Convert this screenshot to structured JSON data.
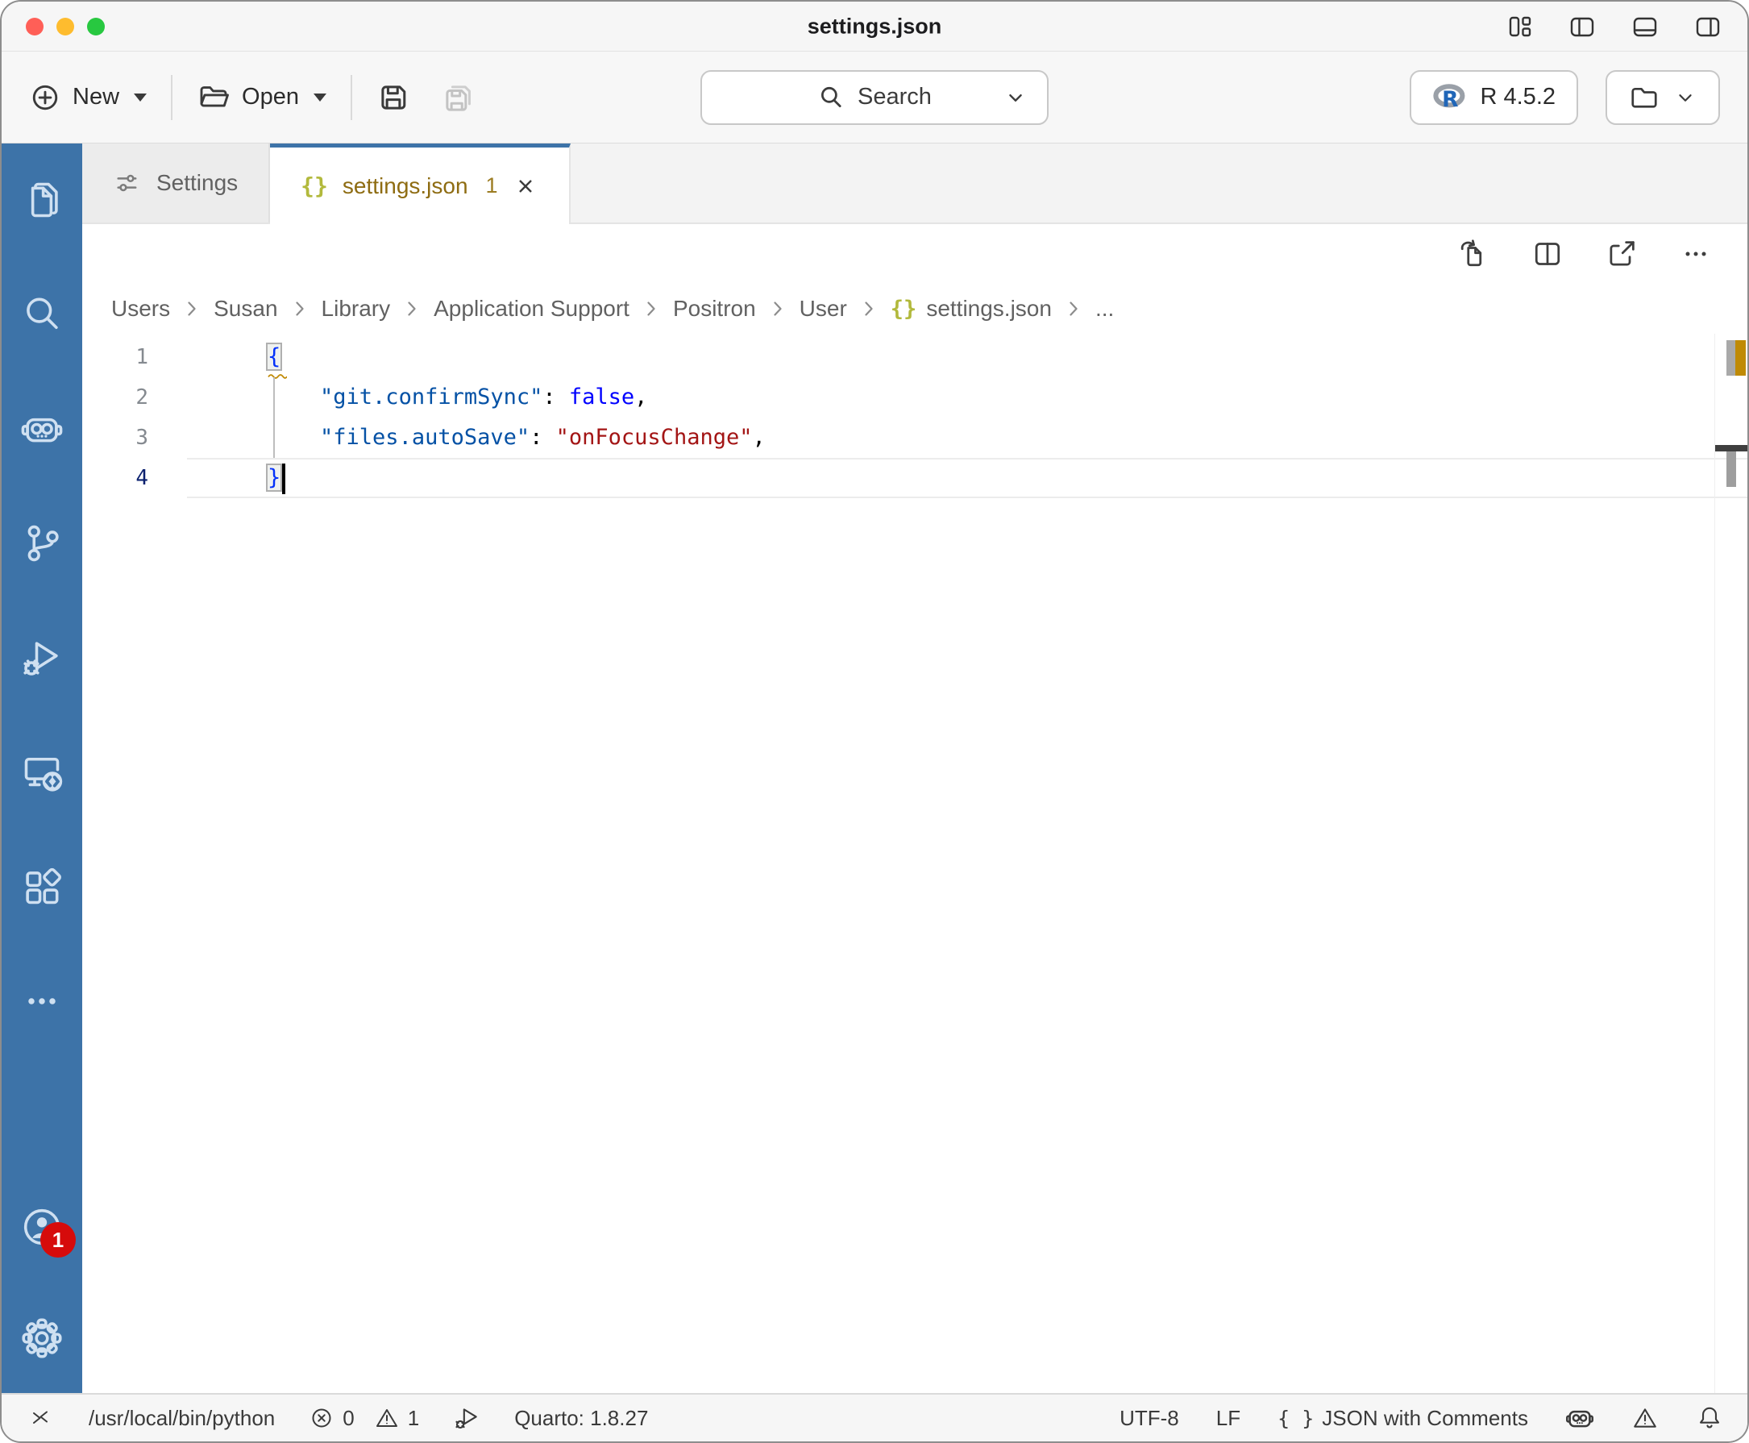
{
  "window": {
    "title": "settings.json"
  },
  "toolbar": {
    "new_label": "New",
    "open_label": "Open",
    "search_label": "Search",
    "r_runtime_label": "R 4.5.2"
  },
  "tabs": [
    {
      "label": "Settings"
    },
    {
      "label": "settings.json",
      "badge": "1"
    }
  ],
  "breadcrumb": {
    "items": [
      {
        "label": "Users"
      },
      {
        "label": "Susan"
      },
      {
        "label": "Library"
      },
      {
        "label": "Application Support"
      },
      {
        "label": "Positron"
      },
      {
        "label": "User"
      },
      {
        "label": "settings.json",
        "icon": "{}"
      },
      {
        "label": "..."
      }
    ]
  },
  "editor": {
    "lines": [
      {
        "num": "1",
        "tokens": [
          {
            "t": "{",
            "c": "br",
            "match": true,
            "squiggle": true
          }
        ]
      },
      {
        "num": "2",
        "tokens": [
          {
            "t": "    ",
            "c": "plain"
          },
          {
            "t": "\"git.confirmSync\"",
            "c": "key"
          },
          {
            "t": ": ",
            "c": "plain"
          },
          {
            "t": "false",
            "c": "kw"
          },
          {
            "t": ",",
            "c": "plain"
          }
        ]
      },
      {
        "num": "3",
        "tokens": [
          {
            "t": "    ",
            "c": "plain"
          },
          {
            "t": "\"files.autoSave\"",
            "c": "key"
          },
          {
            "t": ": ",
            "c": "plain"
          },
          {
            "t": "\"onFocusChange\"",
            "c": "str"
          },
          {
            "t": ",",
            "c": "plain"
          }
        ]
      },
      {
        "num": "4",
        "active": true,
        "current": true,
        "cursor": true,
        "tokens": [
          {
            "t": "}",
            "c": "br",
            "match": true
          }
        ]
      }
    ]
  },
  "status_bar": {
    "python_path": "/usr/local/bin/python",
    "errors": "0",
    "warnings": "1",
    "quarto": "Quarto: 1.8.27",
    "encoding": "UTF-8",
    "eol": "LF",
    "language_icon": "{ }",
    "language": "JSON with Comments"
  },
  "activity_badge": "1",
  "colors": {
    "activity_bar": "#3d73a8",
    "accent_blue": "#3d73a8",
    "badge_red": "#d60b0b",
    "warning_amber": "#bf8a05",
    "tab_warning_text": "#8e6c12",
    "json_icon_olive": "#b2b93c",
    "token_key": "#0451a5",
    "token_keyword": "#0000ff",
    "token_string": "#a31515",
    "token_bracket": "#0431fa"
  }
}
